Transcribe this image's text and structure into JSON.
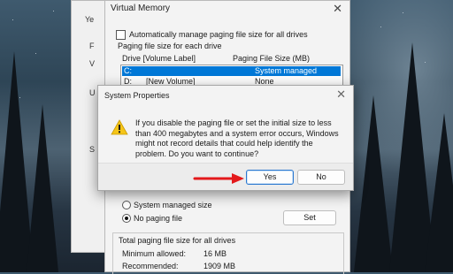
{
  "background_window": {
    "letters": [
      "Ye",
      "F",
      "V",
      "U",
      "S"
    ]
  },
  "virtual_memory": {
    "title": "Virtual Memory",
    "close_label": "✕",
    "auto_manage_label": "Automatically manage paging file size for all drives",
    "auto_manage_checked": false,
    "paging_group_label": "Paging file size for each drive",
    "col_drive": "Drive  [Volume Label]",
    "col_size": "Paging File Size (MB)",
    "drives": [
      {
        "drive": "C:",
        "label": "",
        "size": "System managed",
        "selected": true
      },
      {
        "drive": "D:",
        "label": "[New Volume]",
        "size": "None",
        "selected": false
      }
    ],
    "options": {
      "system_managed_label": "System managed size",
      "no_paging_label": "No paging file",
      "selected": "no_paging"
    },
    "set_button": "Set",
    "totals_label": "Total paging file size for all drives",
    "minimum_label": "Minimum allowed:",
    "minimum_value": "16 MB",
    "recommended_label": "Recommended:",
    "recommended_value": "1909 MB"
  },
  "dialog": {
    "title": "System Properties",
    "close_label": "✕",
    "message": "If you disable the paging file or set the initial size to less than 400 megabytes and a system error occurs, Windows might not record details that could help identify the problem. Do you want to continue?",
    "yes_button": "Yes",
    "no_button": "No",
    "icon": "warning-icon"
  },
  "colors": {
    "selection": "#0078d7",
    "annotation_arrow": "#e3191b",
    "warning_fill": "#f5c518"
  }
}
